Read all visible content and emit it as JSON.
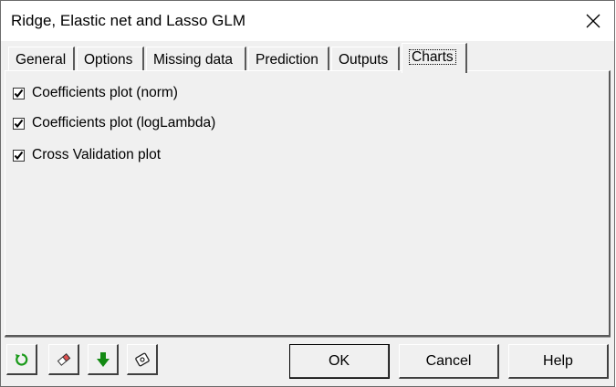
{
  "window": {
    "title": "Ridge, Elastic net and Lasso GLM"
  },
  "tabs": [
    {
      "label": "General"
    },
    {
      "label": "Options"
    },
    {
      "label": "Missing data"
    },
    {
      "label": "Prediction"
    },
    {
      "label": "Outputs"
    },
    {
      "label": "Charts",
      "active": true
    }
  ],
  "charts": {
    "options": [
      {
        "label": "Coefficients plot (norm)",
        "checked": true
      },
      {
        "label": "Coefficients plot (logLambda)",
        "checked": true
      },
      {
        "label": "Cross Validation plot",
        "checked": true
      }
    ]
  },
  "toolbar": {
    "icons": [
      "reset-icon",
      "eraser-icon",
      "down-arrow-icon",
      "save-icon"
    ],
    "ok_label": "OK",
    "cancel_label": "Cancel",
    "help_label": "Help"
  },
  "colors": {
    "reset_icon": "#1a9a1a",
    "down_arrow_icon": "#138a13"
  }
}
